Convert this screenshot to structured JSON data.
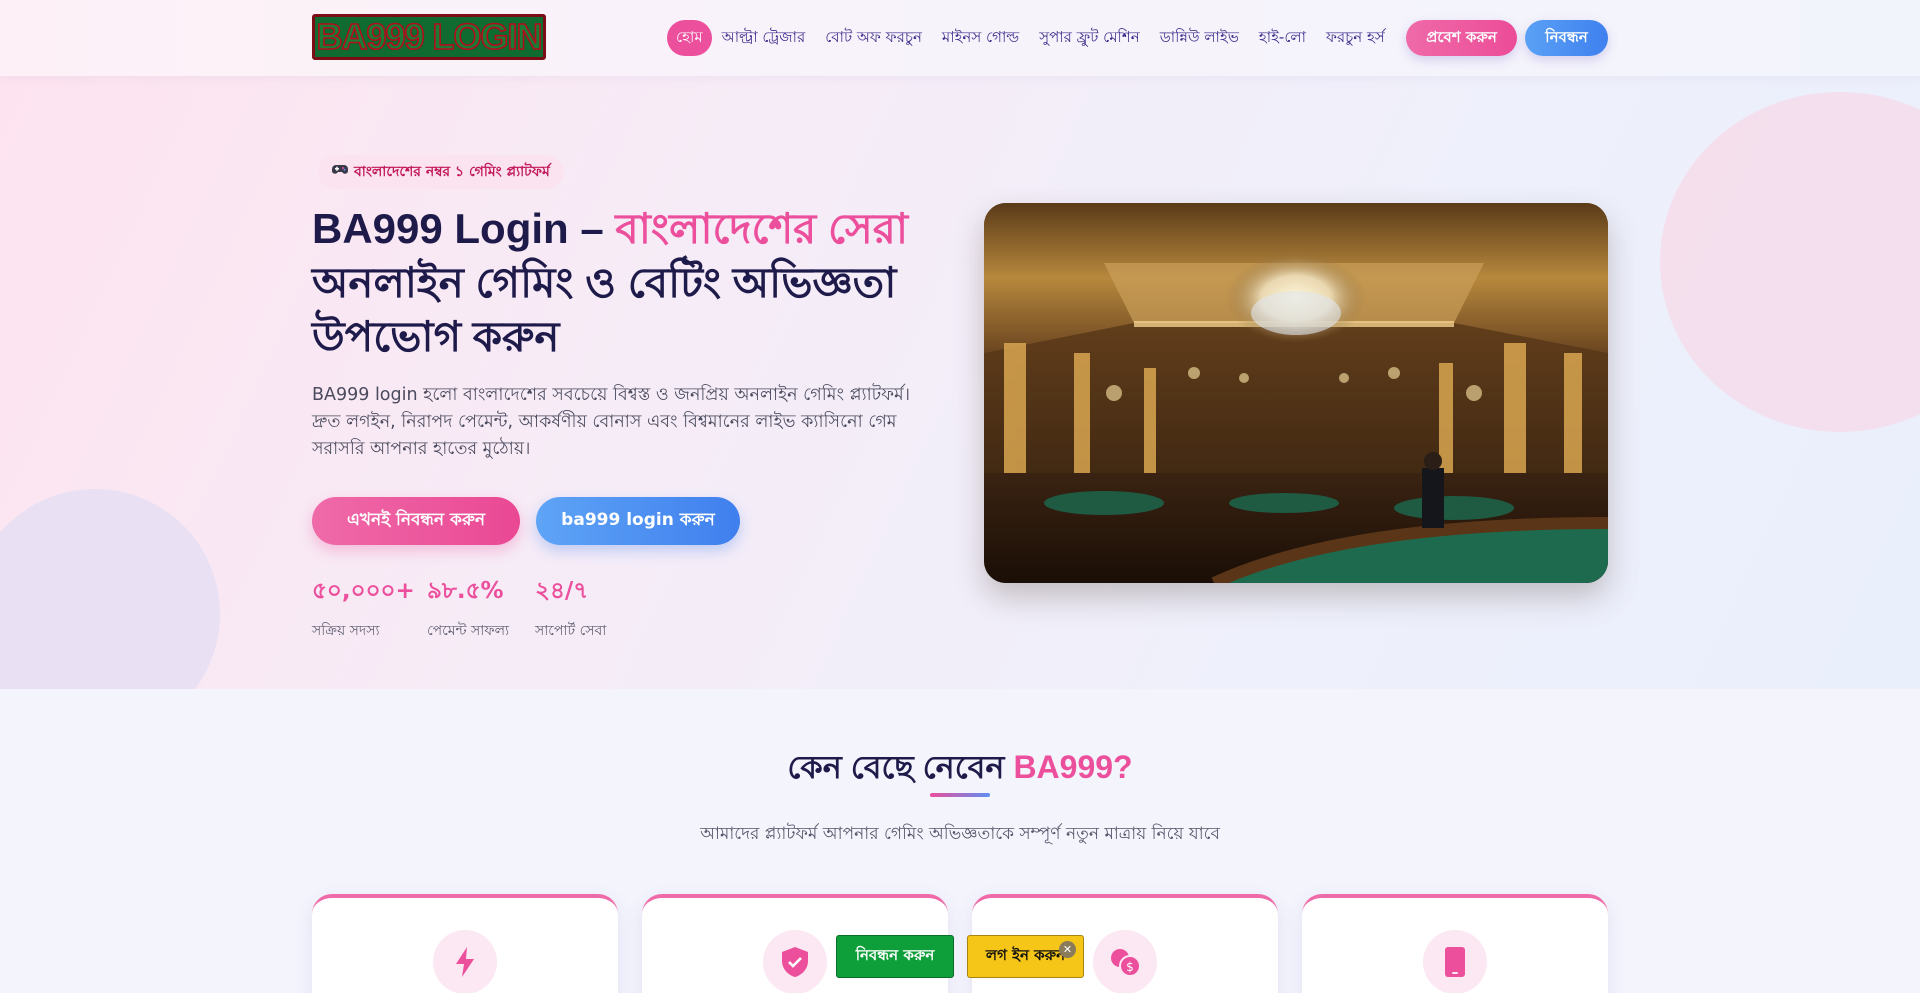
{
  "header": {
    "logo_text": "BA999 LOGIN",
    "nav": [
      {
        "label": "হোম",
        "active": true
      },
      {
        "label": "আল্ট্রা ট্রেজার"
      },
      {
        "label": "বোট অফ ফরচুন"
      },
      {
        "label": "মাইনস গোল্ড"
      },
      {
        "label": "সুপার ফ্রুট মেশিন"
      },
      {
        "label": "ডান্নিউ লাইভ"
      },
      {
        "label": "হাই-লো"
      },
      {
        "label": "ফরচুন হর্স"
      }
    ],
    "login_label": "প্রবেশ করুন",
    "register_label": "নিবন্ধন"
  },
  "hero": {
    "badge_icon": "gamepad-icon",
    "badge": "বাংলাদেশের নম্বর ১ গেমিং প্ল্যাটফর্ম",
    "title_part1": "BA999 Login – ",
    "title_highlight": "বাংলাদেশের সেরা",
    "title_part2": "অনলাইন গেমিং ও বেটিং অভিজ্ঞতা উপভোগ করুন",
    "description": "BA999 login হলো বাংলাদেশের সবচেয়ে বিশ্বস্ত ও জনপ্রিয় অনলাইন গেমিং প্ল্যাটফর্ম। দ্রুত লগইন, নিরাপদ পেমেন্ট, আকর্ষণীয় বোনাস এবং বিশ্বমানের লাইভ ক্যাসিনো গেম সরাসরি আপনার হাতের মুঠোয়।",
    "cta_register": "এখনই নিবন্ধন করুন",
    "cta_login": "ba999 login করুন",
    "stats": [
      {
        "value": "৫০,০০০+",
        "label": "সক্রিয় সদস্য"
      },
      {
        "value": "৯৮.৫%",
        "label": "পেমেন্ট সাফল্য"
      },
      {
        "value": "২৪/৭",
        "label": "সাপোর্ট সেবা"
      }
    ]
  },
  "why": {
    "title_part1": "কেন বেছে নেবেন ",
    "title_highlight": "BA999?",
    "subtitle": "আমাদের প্ল্যাটফর্ম আপনার গেমিং অভিজ্ঞতাকে সম্পূর্ণ নতুন মাত্রায় নিয়ে যাবে",
    "cards": [
      {
        "icon": "lightning-icon"
      },
      {
        "icon": "shield-check-icon"
      },
      {
        "icon": "coins-icon"
      },
      {
        "icon": "mobile-phone-icon"
      }
    ]
  },
  "floating_bar": {
    "register_label": "নিবন্ধন করুন",
    "login_label": "লগ ইন করুন",
    "close_label": "✕"
  },
  "colors": {
    "accent_pink": "#ec4f9c",
    "accent_blue": "#3f80ef",
    "heading_navy": "#1e1b4b",
    "float_green": "#0e9f3a",
    "float_yellow": "#f5c518"
  }
}
